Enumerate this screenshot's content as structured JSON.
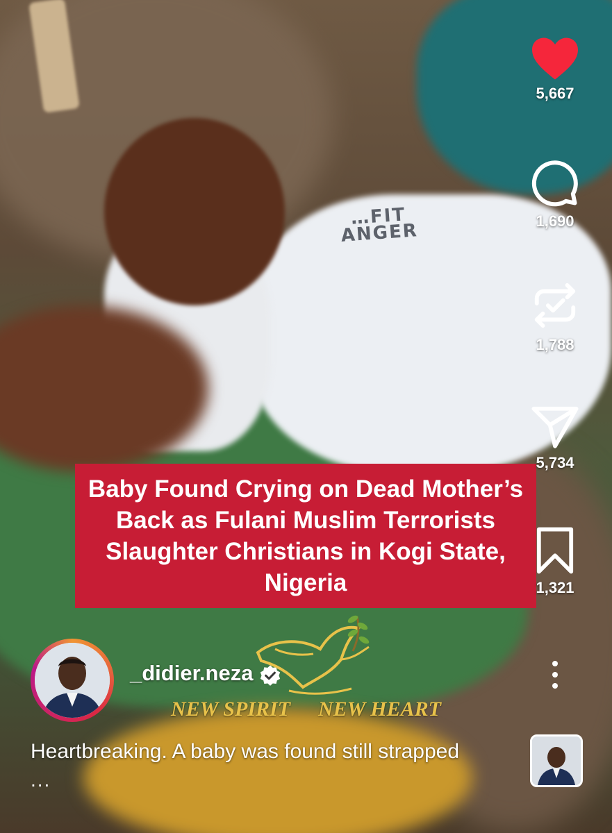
{
  "post": {
    "headline": "Baby Found Crying on Dead Mother’s Back as Fulani Muslim Terrorists Slaughter Christians in Kogi State, Nigeria",
    "shirt_text": "…FIT\nANGER",
    "watermark": {
      "left_text": "NEW SPIRIT",
      "right_text": "NEW HEART",
      "icon": "dove-with-olive-branch-icon"
    },
    "caption": "Heartbreaking. A baby was found still strapped",
    "caption_more": "..."
  },
  "author": {
    "username": "_didier.neza",
    "verified": true,
    "avatar_icon": "profile-photo"
  },
  "actions": {
    "like": {
      "count": "5,667",
      "icon": "heart-filled-icon",
      "color": "#f5263b"
    },
    "comment": {
      "count": "1,690",
      "icon": "comment-bubble-icon"
    },
    "repost": {
      "count": "1,788",
      "icon": "repost-icon"
    },
    "share": {
      "count": "5,734",
      "icon": "send-icon"
    },
    "save": {
      "count": "1,321",
      "icon": "bookmark-icon"
    },
    "more": {
      "icon": "vertical-ellipsis-icon"
    }
  },
  "colors": {
    "banner": "#c71d35",
    "text": "#ffffff"
  }
}
